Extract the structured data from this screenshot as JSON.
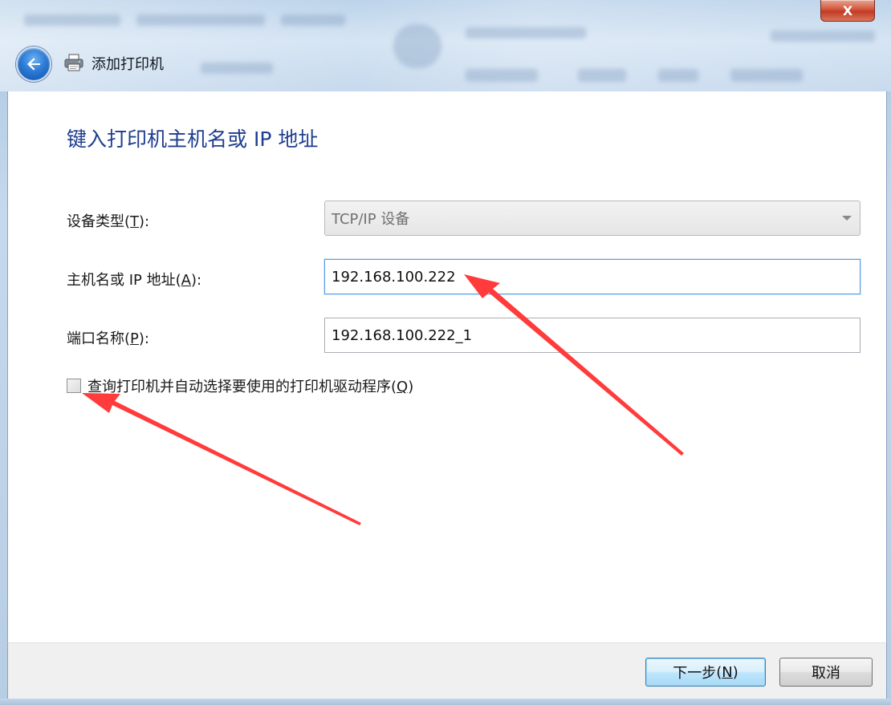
{
  "window": {
    "title": "添加打印机",
    "close_label": "X"
  },
  "icons": {
    "back": "back-arrow-icon",
    "printer": "printer-icon",
    "dropdown": "chevron-down-icon"
  },
  "page": {
    "heading": "键入打印机主机名或 IP 地址"
  },
  "form": {
    "device_type": {
      "label": "设备类型",
      "mnemonic": "T",
      "value": "TCP/IP 设备"
    },
    "hostname": {
      "label": "主机名或 IP 地址",
      "mnemonic": "A",
      "value": "192.168.100.222"
    },
    "port_name": {
      "label": "端口名称",
      "mnemonic": "P",
      "value": "192.168.100.222_1"
    },
    "query_driver": {
      "label": "查询打印机并自动选择要使用的打印机驱动程序",
      "mnemonic": "Q",
      "checked": false
    }
  },
  "footer": {
    "next": {
      "label": "下一步",
      "mnemonic": "N"
    },
    "cancel": {
      "label": "取消"
    }
  },
  "colors": {
    "heading": "#1e3d8f",
    "annotation_arrow": "#ff3b3b"
  }
}
